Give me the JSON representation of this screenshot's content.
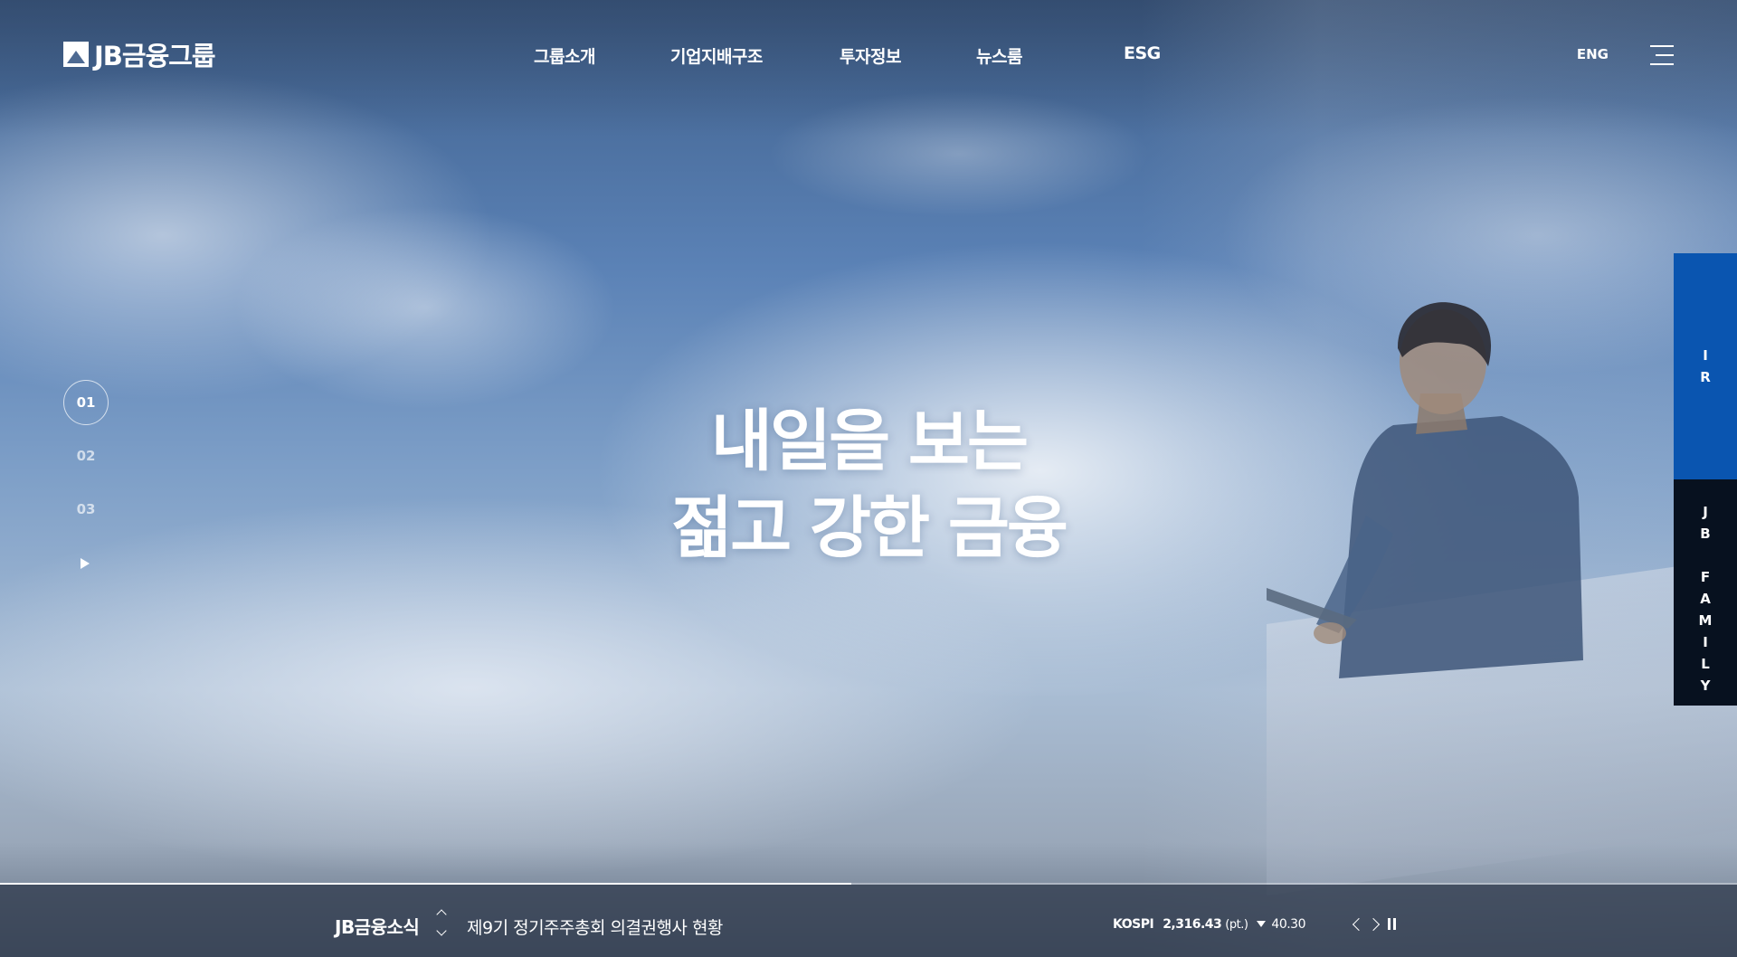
{
  "brand": {
    "logo_text": "JB금융그룹"
  },
  "nav": {
    "items": [
      {
        "label": "그룹소개"
      },
      {
        "label": "기업지배구조"
      },
      {
        "label": "투자정보"
      },
      {
        "label": "뉴스룸"
      },
      {
        "label": "ESG"
      }
    ],
    "lang": "ENG"
  },
  "hero": {
    "line1": "내일을 보는",
    "line2": "젊고 강한 금융"
  },
  "pager": {
    "items": [
      "01",
      "02",
      "03"
    ],
    "active": "01",
    "progress": 0.49
  },
  "side": {
    "ir": "I\nR",
    "family": "J\nB\n\nF\nA\nM\nI\nL\nY"
  },
  "news": {
    "title": "JB금융소식",
    "item": "제9기 정기주주총회 의결권행사 현황"
  },
  "stock": {
    "label": "KOSPI",
    "value": "2,316.43",
    "unit": "(pt.)",
    "direction": "down",
    "change": "40.30"
  },
  "colors": {
    "ir_tab": "#0a55b0",
    "family_tab": "#07111f",
    "bottom_bar": "#344052"
  }
}
